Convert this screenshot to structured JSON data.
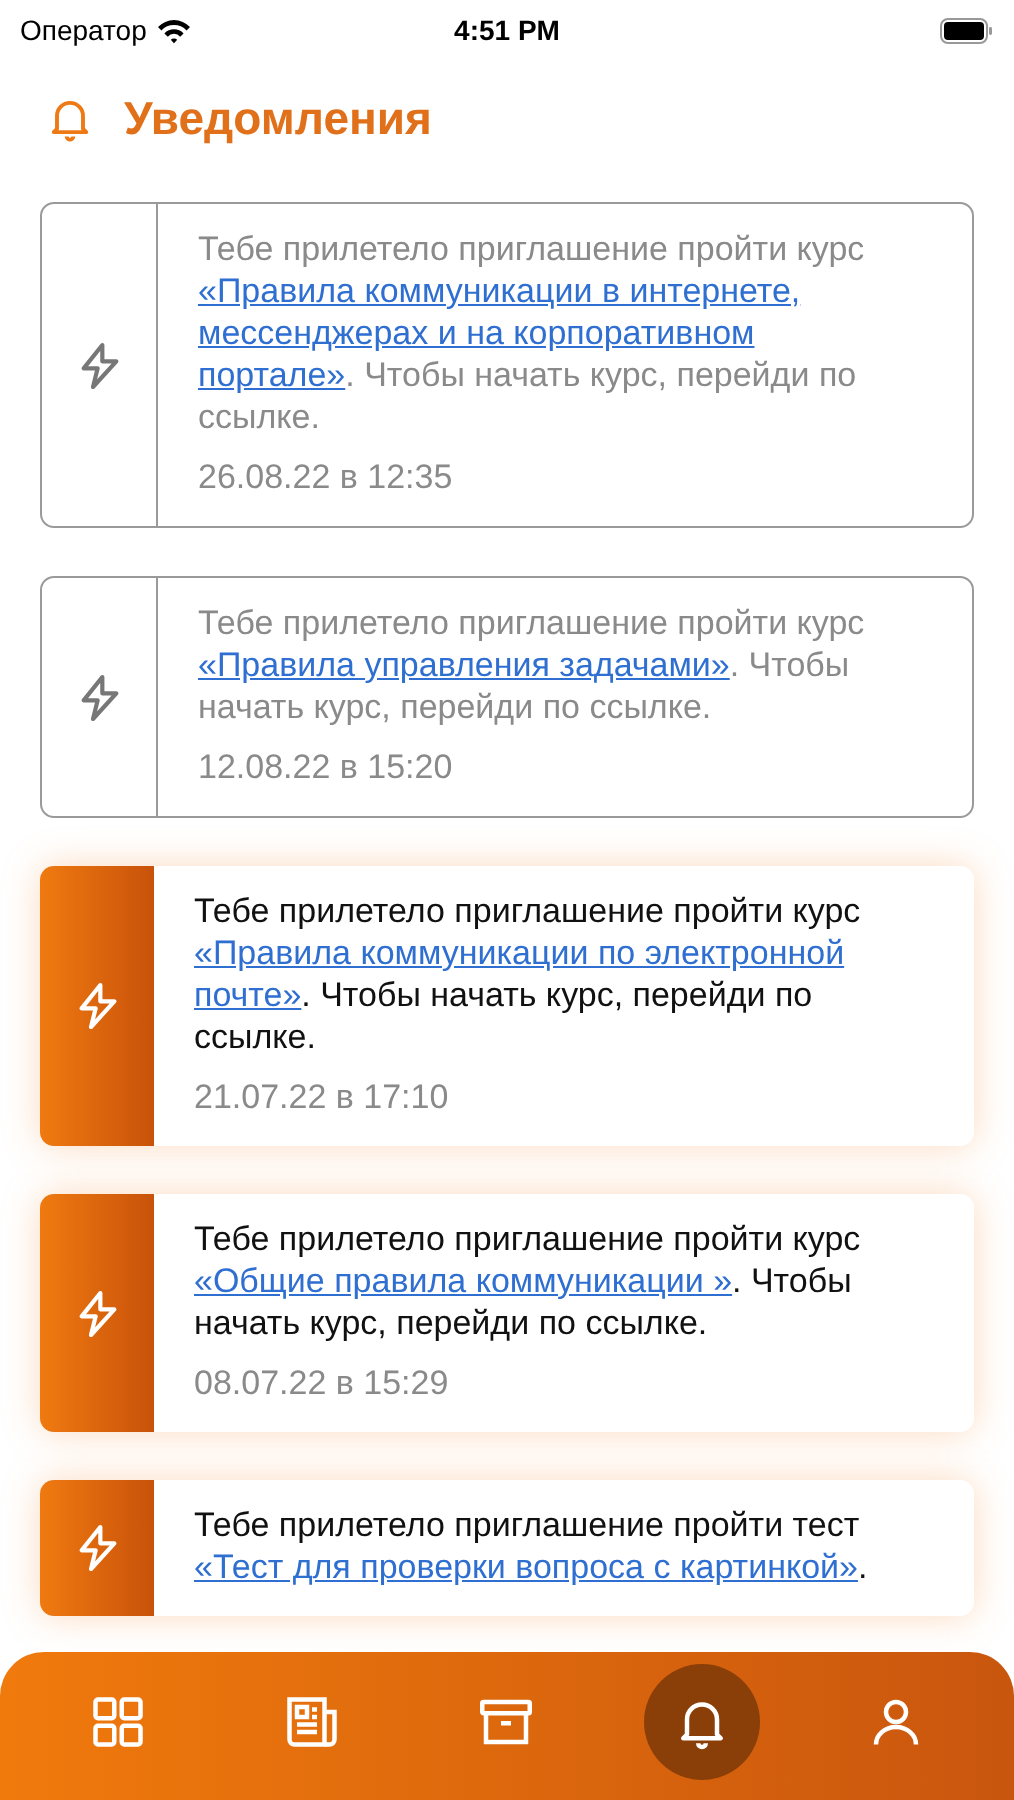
{
  "status_bar": {
    "carrier": "Оператор",
    "time": "4:51 PM"
  },
  "header": {
    "title": "Уведомления"
  },
  "notifications": [
    {
      "read": true,
      "date": "26.08.22 в 12:35",
      "lines": [
        [
          {
            "kind": "text",
            "text": "Тебе прилетело приглашение пройти курс"
          }
        ],
        [
          {
            "kind": "link",
            "text": "«Правила коммуникации в интернете,"
          }
        ],
        [
          {
            "kind": "link",
            "text": "мессенджерах и на корпоративном"
          }
        ],
        [
          {
            "kind": "link",
            "text": "портале»"
          },
          {
            "kind": "text",
            "text": ". Чтобы начать курс, перейди по"
          }
        ],
        [
          {
            "kind": "text",
            "text": "ссылке."
          }
        ]
      ]
    },
    {
      "read": true,
      "date": "12.08.22 в 15:20",
      "lines": [
        [
          {
            "kind": "text",
            "text": "Тебе прилетело приглашение пройти курс"
          }
        ],
        [
          {
            "kind": "link",
            "text": "«Правила управления задачами»"
          },
          {
            "kind": "text",
            "text": ". Чтобы"
          }
        ],
        [
          {
            "kind": "text",
            "text": "начать курс, перейди по ссылке."
          }
        ]
      ]
    },
    {
      "read": false,
      "date": "21.07.22 в 17:10",
      "lines": [
        [
          {
            "kind": "text",
            "text": "Тебе прилетело приглашение пройти курс"
          }
        ],
        [
          {
            "kind": "link",
            "text": "«Правила коммуникации по электронной"
          }
        ],
        [
          {
            "kind": "link",
            "text": "почте»"
          },
          {
            "kind": "text",
            "text": ". Чтобы начать курс, перейди по"
          }
        ],
        [
          {
            "kind": "text",
            "text": "ссылке."
          }
        ]
      ]
    },
    {
      "read": false,
      "date": "08.07.22 в 15:29",
      "lines": [
        [
          {
            "kind": "text",
            "text": "Тебе прилетело приглашение пройти курс"
          }
        ],
        [
          {
            "kind": "link",
            "text": "«Общие правила коммуникации »"
          },
          {
            "kind": "text",
            "text": ". Чтобы"
          }
        ],
        [
          {
            "kind": "text",
            "text": "начать курс, перейди по ссылке."
          }
        ]
      ]
    },
    {
      "read": false,
      "lines": [
        [
          {
            "kind": "text",
            "text": "Тебе прилетело приглашение пройти тест"
          }
        ],
        [
          {
            "kind": "link",
            "text": "«Тест для проверки вопроса с картинкой»"
          },
          {
            "kind": "text",
            "text": "."
          }
        ]
      ]
    }
  ],
  "tab_bar": [
    {
      "kind": "grid",
      "selected": false
    },
    {
      "kind": "news",
      "selected": false
    },
    {
      "kind": "archive",
      "selected": false
    },
    {
      "kind": "bell",
      "selected": true
    },
    {
      "kind": "person",
      "selected": false
    }
  ]
}
